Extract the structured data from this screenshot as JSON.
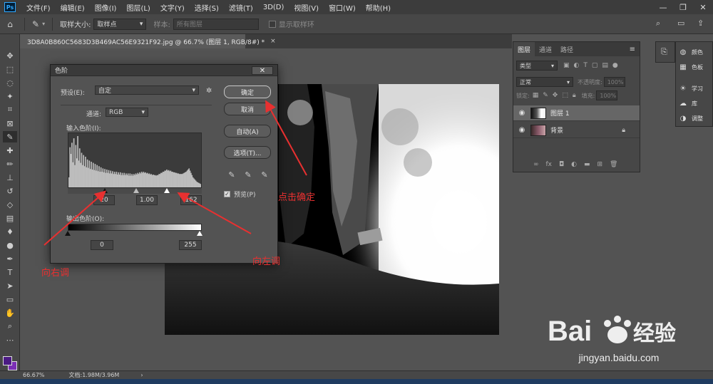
{
  "menu": {
    "logo": "Ps",
    "items": [
      "文件(F)",
      "编辑(E)",
      "图像(I)",
      "图层(L)",
      "文字(Y)",
      "选择(S)",
      "滤镜(T)",
      "3D(D)",
      "视图(V)",
      "窗口(W)",
      "帮助(H)"
    ]
  },
  "window_controls": {
    "minimize": "—",
    "restore": "❐",
    "close": "✕"
  },
  "options_bar": {
    "sample_size_label": "取样大小:",
    "sample_size_value": "取样点",
    "sample_label": "样本:",
    "sample_value": "所有图层",
    "show_ring_label": "显示取样环"
  },
  "document": {
    "tab_title": "3D8A0B860C5683D3B469AC56E9321F92.jpg @ 66.7% (图层 1, RGB/8#) *",
    "tab_close": "×"
  },
  "levels_dialog": {
    "title": "色阶",
    "close": "✕",
    "preset_label": "预设(E):",
    "preset_value": "自定",
    "channel_label": "通道:",
    "channel_value": "RGB",
    "input_levels_label": "输入色阶(I):",
    "input_black": "20",
    "input_gamma": "1.00",
    "input_white": "162",
    "output_levels_label": "输出色阶(O):",
    "output_black": "0",
    "output_white": "255",
    "buttons": {
      "ok": "确定",
      "cancel": "取消",
      "auto": "自动(A)",
      "options": "选项(T)..."
    },
    "preview_label": "预览(P)",
    "histogram": [
      18,
      72,
      60,
      80,
      45,
      88,
      40,
      76,
      52,
      92,
      48,
      70,
      44,
      62,
      40,
      58,
      38,
      55,
      36,
      50,
      35,
      48,
      33,
      46,
      32,
      44,
      31,
      42,
      30,
      40,
      29,
      38,
      28,
      36,
      28,
      34,
      27,
      33,
      26,
      32,
      26,
      31,
      25,
      30,
      25,
      29,
      24,
      28,
      24,
      28,
      23,
      27,
      23,
      27,
      22,
      26,
      22,
      26,
      22,
      25,
      22,
      25,
      21,
      25,
      21,
      24,
      21,
      24,
      22,
      25,
      23,
      26,
      24,
      27,
      25,
      28,
      26,
      28,
      26,
      27,
      25,
      26,
      24,
      25,
      23,
      24,
      22,
      23,
      22,
      22,
      21,
      22,
      22,
      24,
      24,
      26,
      26,
      28,
      28,
      30,
      30,
      32,
      30,
      31,
      29,
      30,
      28,
      28,
      27,
      27,
      26,
      26,
      25,
      25,
      24,
      24,
      24,
      24,
      25,
      26,
      27,
      28,
      30,
      32,
      34,
      30,
      26,
      22,
      18,
      16,
      14,
      12,
      10,
      9,
      8,
      7,
      6
    ]
  },
  "layers_panel": {
    "tabs": [
      "图层",
      "通道",
      "路径"
    ],
    "kind_filter": "类型",
    "blend_mode": "正常",
    "opacity_label": "不透明度:",
    "opacity_value": "100%",
    "lock_label": "锁定:",
    "fill_label": "填充:",
    "fill_value": "100%",
    "layers": [
      {
        "name": "图层 1",
        "selected": true
      },
      {
        "name": "背景",
        "selected": false
      }
    ]
  },
  "right_panel": {
    "items": [
      "颜色",
      "色板",
      "学习",
      "库",
      "调整"
    ]
  },
  "status_bar": {
    "zoom": "66.67%",
    "doc_info": "文档:1.98M/3.96M"
  },
  "annotations": {
    "click_ok": "点击确定",
    "move_right": "向右调",
    "move_left": "向左调"
  },
  "watermark": {
    "url": "jingyan.baidu.com"
  },
  "colors": {
    "foreground": "#4b1a84",
    "background": "#7b2fb5",
    "annotation": "#e83030"
  }
}
